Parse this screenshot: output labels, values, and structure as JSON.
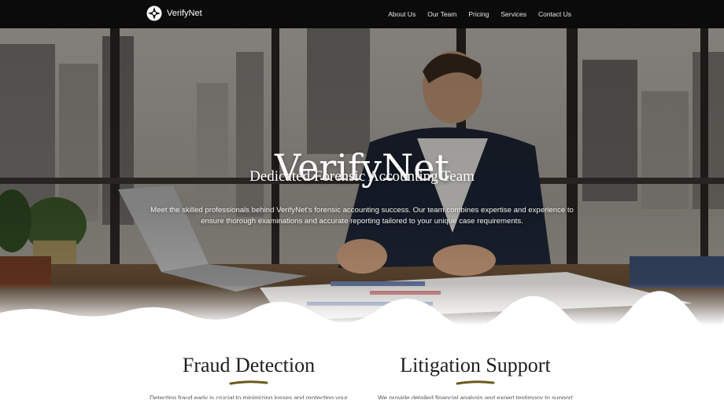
{
  "nav": {
    "brand": "VerifyNet",
    "links": [
      "About Us",
      "Our Team",
      "Pricing",
      "Services",
      "Contact Us"
    ]
  },
  "hero": {
    "title": "VerifyNet",
    "subtitle": "Dedicated Forensic Accounting Team",
    "description": "Meet the skilled professionals behind VerifyNet's forensic accounting success. Our team combines expertise and experience to ensure thorough examinations and accurate reporting tailored to your unique case requirements."
  },
  "services": [
    {
      "title": "Fraud Detection",
      "text": "Detecting fraud early is crucial to minimizing losses and protecting your"
    },
    {
      "title": "Litigation Support",
      "text": "We provide detailed financial analysis and expert testimony to support"
    }
  ],
  "colors": {
    "nav_bg": "#0b0b0b",
    "underline": "#6b5a1e",
    "title_text": "#1e1e1e"
  }
}
